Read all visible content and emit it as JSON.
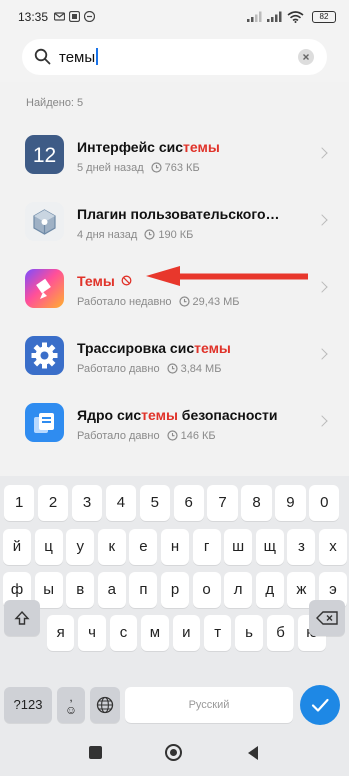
{
  "status_bar": {
    "time": "13:35",
    "battery": "82"
  },
  "search": {
    "query": "темы"
  },
  "results_header": "Найдено: 5",
  "results": [
    {
      "title_pre": "Интерфейс сис",
      "title_hl": "темы",
      "title_post": "",
      "age": "5 дней назад",
      "size": "763 КБ",
      "icon": "miui-12-icon"
    },
    {
      "title_pre": "Плагин пользовательского…",
      "title_hl": "",
      "title_post": "",
      "age": "4 дня назад",
      "size": "190 КБ",
      "icon": "cube-plugin-icon"
    },
    {
      "title_pre": "",
      "title_hl": "Темы",
      "title_post": "",
      "age": "Работало недавно",
      "size": "29,43 МБ",
      "icon": "themes-brush-icon"
    },
    {
      "title_pre": "Трассировка сис",
      "title_hl": "темы",
      "title_post": "",
      "age": "Работало давно",
      "size": "3,84 МБ",
      "icon": "gear-icon"
    },
    {
      "title_pre": "Ядро сис",
      "title_hl": "темы",
      "title_post": " безопасности",
      "age": "Работало давно",
      "size": "146 КБ",
      "icon": "security-core-icon"
    }
  ],
  "keyboard": {
    "row1": [
      "1",
      "2",
      "3",
      "4",
      "5",
      "6",
      "7",
      "8",
      "9",
      "0"
    ],
    "row2": [
      "й",
      "ц",
      "у",
      "к",
      "е",
      "н",
      "г",
      "ш",
      "щ",
      "з",
      "х"
    ],
    "row3": [
      "ф",
      "ы",
      "в",
      "а",
      "п",
      "р",
      "о",
      "л",
      "д",
      "ж",
      "э"
    ],
    "row4": [
      "я",
      "ч",
      "с",
      "м",
      "и",
      "т",
      "ь",
      "б",
      "ю"
    ],
    "symbols_label": "?123",
    "emoji_label": "☺",
    "space_label": "Русский",
    "comma_label": ","
  },
  "colors": {
    "highlight": "#e0332a",
    "accent": "#1e88e5",
    "annotation_arrow": "#e8372c"
  }
}
